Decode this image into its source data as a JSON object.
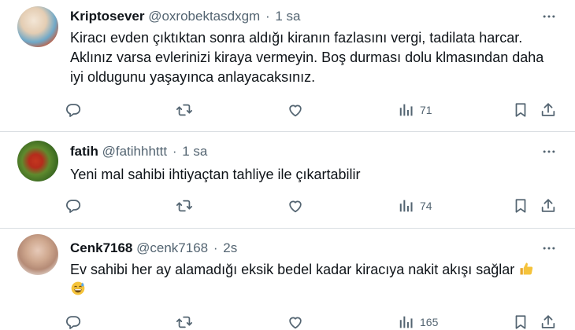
{
  "tweets": [
    {
      "name": "Kriptosever",
      "handle": "@oxrobektasdxgm",
      "dot": "·",
      "time": "1 sa",
      "lines": [
        "Kiracı evden çıktıktan sonra aldığı kiranın fazlasını vergi, tadilata harcar.",
        "Aklınız varsa evlerinizi kiraya vermeyin. Boş durması dolu klmasından daha",
        "iyi oldugunu yaşayınca anlayacaksınız."
      ],
      "views": "71"
    },
    {
      "name": "fatih",
      "handle": "@fatihhhttt",
      "dot": "·",
      "time": "1 sa",
      "lines": [
        "Yeni mal sahibi ihtiyaçtan tahliye ile çıkartabilir"
      ],
      "views": "74"
    },
    {
      "name": "Cenk7168",
      "handle": "@cenk7168",
      "dot": "·",
      "time": "2s",
      "lines": [
        "Ev sahibi her ay  alamadığı eksik bedel kadar kiracıya nakit akışı sağlar"
      ],
      "emojis": [
        "thumbs-up",
        "grinning-sweat"
      ],
      "views": "165"
    }
  ],
  "icons": {
    "reply": "reply-icon",
    "retweet": "retweet-icon",
    "like": "heart-icon",
    "views": "views-bar-icon",
    "bookmark": "bookmark-icon",
    "share": "share-icon",
    "more": "more-dots-icon"
  },
  "colors": {
    "text": "#0f1419",
    "secondary": "#536471",
    "divider": "#d9dee2",
    "background": "#ffffff"
  }
}
